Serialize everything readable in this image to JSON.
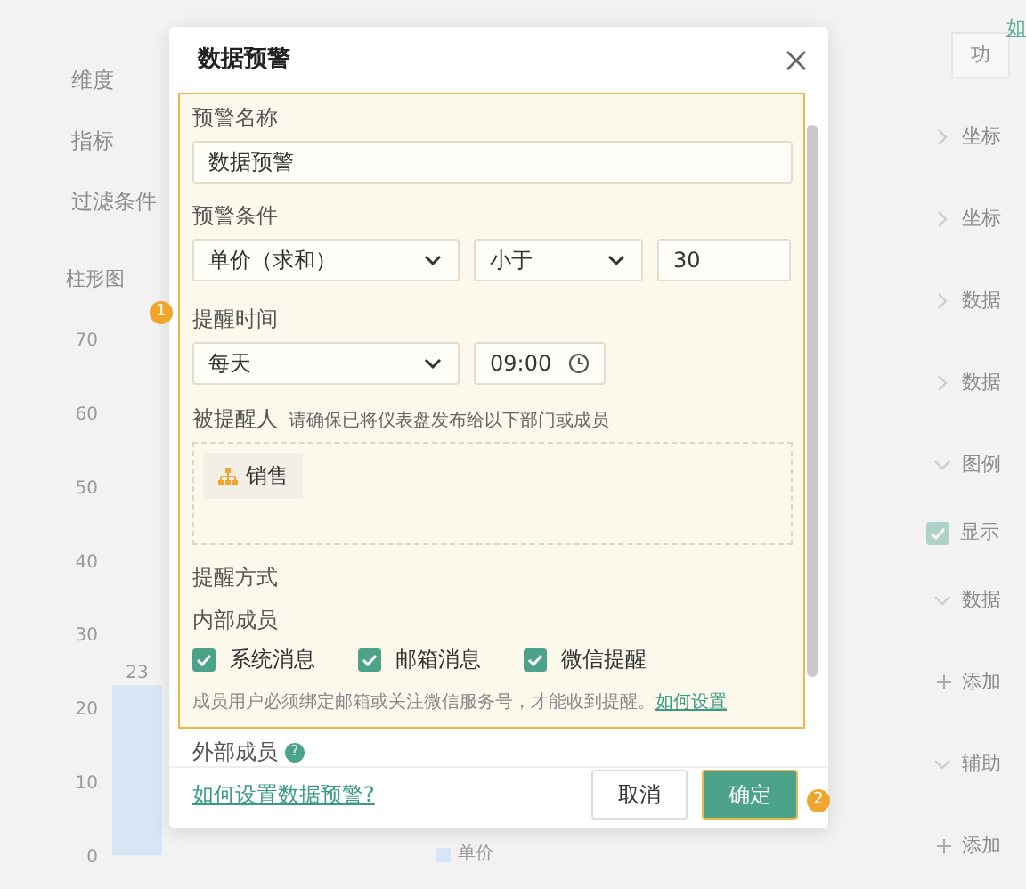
{
  "background": {
    "top_link": "如",
    "left_labels": [
      {
        "label": "维度"
      },
      {
        "label": "指标"
      },
      {
        "label": "过滤条件"
      }
    ],
    "chart": {
      "chart_data": {
        "type": "bar",
        "title": "柱形图",
        "series": [
          {
            "name": "单价",
            "color": "#d6e6f7",
            "values": [
              23
            ]
          }
        ],
        "ylim": [
          0,
          70
        ],
        "yticks": [
          0,
          10,
          20,
          30,
          40,
          50,
          60,
          70
        ],
        "data_labels": true
      }
    },
    "right_items": [
      {
        "kind": "button",
        "label": "功"
      },
      {
        "kind": "section",
        "label": "坐标",
        "expanded": false
      },
      {
        "kind": "section",
        "label": "坐标",
        "expanded": false
      },
      {
        "kind": "section",
        "label": "数据",
        "expanded": false
      },
      {
        "kind": "section",
        "label": "数据",
        "expanded": false
      },
      {
        "kind": "section",
        "label": "图例",
        "expanded": true
      },
      {
        "kind": "checkbox",
        "label": "显示",
        "checked": true
      },
      {
        "kind": "section",
        "label": "数据",
        "expanded": true
      },
      {
        "kind": "add",
        "label": "添加"
      },
      {
        "kind": "section",
        "label": "辅助",
        "expanded": true
      },
      {
        "kind": "add",
        "label": "添加"
      }
    ]
  },
  "dialog": {
    "title": "数据预警",
    "name_label": "预警名称",
    "name_value": "数据预警",
    "condition_label": "预警条件",
    "condition_field": "单价（求和）",
    "condition_operator": "小于",
    "condition_value": "30",
    "time_label": "提醒时间",
    "time_frequency": "每天",
    "time_value": "09:00",
    "recipients_label": "被提醒人",
    "recipients_hint": "请确保已将仪表盘发布给以下部门或成员",
    "recipients": [
      {
        "label": "销售"
      }
    ],
    "method_label": "提醒方式",
    "internal_label": "内部成员",
    "channels": [
      {
        "label": "系统消息",
        "checked": true
      },
      {
        "label": "邮箱消息",
        "checked": true
      },
      {
        "label": "微信提醒",
        "checked": true
      }
    ],
    "note": "成员用户必须绑定邮箱或关注微信服务号，才能收到提醒。",
    "note_link": "如何设置",
    "external_label": "外部成员",
    "external_help": "?",
    "help_link": "如何设置数据预警?",
    "cancel": "取消",
    "confirm": "确定"
  },
  "annotations": [
    {
      "label": "1"
    },
    {
      "label": "2"
    }
  ]
}
